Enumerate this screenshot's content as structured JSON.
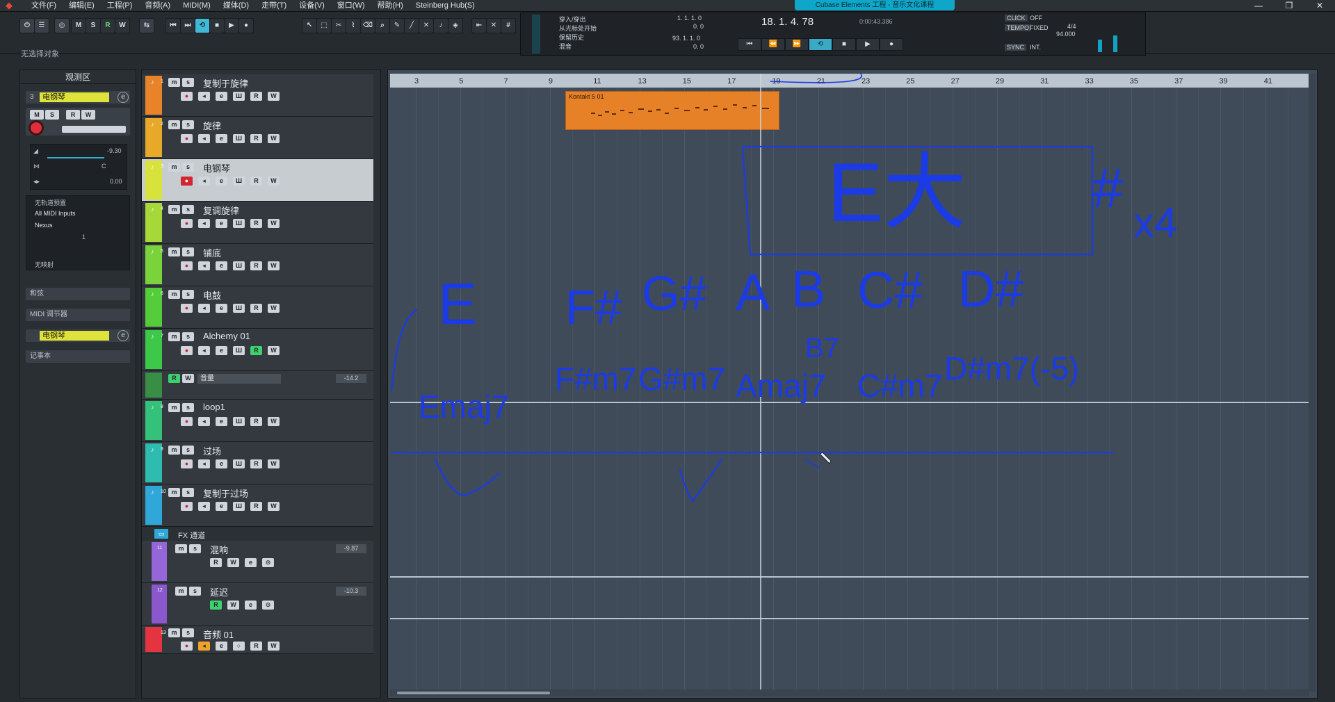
{
  "window": {
    "title": "Cubase Elements 工程 - 音乐文化课程",
    "menu": [
      "文件(F)",
      "编辑(E)",
      "工程(P)",
      "音频(A)",
      "MIDI(M)",
      "媒体(D)",
      "走带(T)",
      "设备(V)",
      "窗口(W)",
      "帮助(H)",
      "Steinberg Hub(S)"
    ],
    "controls": [
      "—",
      "❐",
      "✕"
    ]
  },
  "toolbar": {
    "mode_buttons": [
      "M",
      "S",
      "R",
      "W"
    ],
    "status": "无选择对象"
  },
  "transport": {
    "punch_labels": [
      "穿入/穿出",
      "从光标处开始",
      "保留历史",
      "混音"
    ],
    "left_locator": "1. 1. 1. 0",
    "left_locator_sub": "0. 0",
    "right_locator": "93. 1. 1. 0",
    "right_locator_sub": "0. 0",
    "position": "18. 1. 4. 78",
    "time": "0:00:43.386",
    "click_label": "CLICK",
    "click_value": "OFF",
    "tempo_label": "TEMPO",
    "tempo_mode": "FIXED",
    "signature": "4/4",
    "tempo": "94.000",
    "sync_label": "SYNC",
    "sync_value": "INT."
  },
  "inspector": {
    "title": "观测区",
    "track_num": "3",
    "track_name": "电钢琴",
    "buttons": [
      "M",
      "S",
      "R",
      "W"
    ],
    "volume": "-9.30",
    "pan": "C",
    "delay": "0.00",
    "input_label": "无轨道预置",
    "midi_input": "All MIDI Inputs",
    "output": "Nexus",
    "channel": "1",
    "mapping": "无映射",
    "sections": [
      "和弦",
      "MIDI 调节器",
      "电钢琴",
      "记事本"
    ]
  },
  "tracks": [
    {
      "num": "1",
      "name": "复制于旋律",
      "color": "#e8832a"
    },
    {
      "num": "2",
      "name": "旋律",
      "color": "#e8a82a"
    },
    {
      "num": "3",
      "name": "电钢琴",
      "color": "#d7e23a"
    },
    {
      "num": "4",
      "name": "复调旋律",
      "color": "#a7d83a"
    },
    {
      "num": "5",
      "name": "铺底",
      "color": "#7ad33a"
    },
    {
      "num": "6",
      "name": "电鼓",
      "color": "#55cc3a"
    },
    {
      "num": "7",
      "name": "Alchemy 01",
      "color": "#3ec84a"
    },
    {
      "num": "8",
      "name": "loop1",
      "color": "#34c27a"
    },
    {
      "num": "9",
      "name": "过场",
      "color": "#2fbcb0"
    },
    {
      "num": "10",
      "name": "复制于过场",
      "color": "#2fa7d8"
    }
  ],
  "automation": {
    "label": "音量",
    "value": "-14.2"
  },
  "fx": {
    "folder": "FX 通道",
    "channels": [
      {
        "num": "11",
        "name": "混响",
        "value": "-9.87",
        "color": "#9466d8"
      },
      {
        "num": "12",
        "name": "延迟",
        "value": "-10.3",
        "color": "#8a58cc"
      }
    ]
  },
  "audio_track": {
    "num": "13",
    "name": "音频 01",
    "color": "#e3343f"
  },
  "arrange": {
    "ruler": [
      "3",
      "5",
      "7",
      "9",
      "11",
      "13",
      "15",
      "17",
      "19",
      "21",
      "23",
      "25",
      "27",
      "29",
      "31",
      "33",
      "35",
      "37",
      "39",
      "41"
    ],
    "clip_name": "Kontakt 5 01"
  },
  "annotations": {
    "box": "E大",
    "sharps": "#",
    "times": "x4",
    "scale": [
      "E",
      "F#",
      "G#",
      "A",
      "B",
      "C#",
      "D#"
    ],
    "chords": [
      "Emaj7",
      "F#m7",
      "G#m7",
      "Amaj7",
      "B7",
      "C#m7",
      "D#m7(-5)"
    ]
  },
  "colors": {
    "accent": "#40b8d6",
    "annotation": "#1a3be6",
    "clip": "#e78128",
    "record": "#e02e3a"
  }
}
